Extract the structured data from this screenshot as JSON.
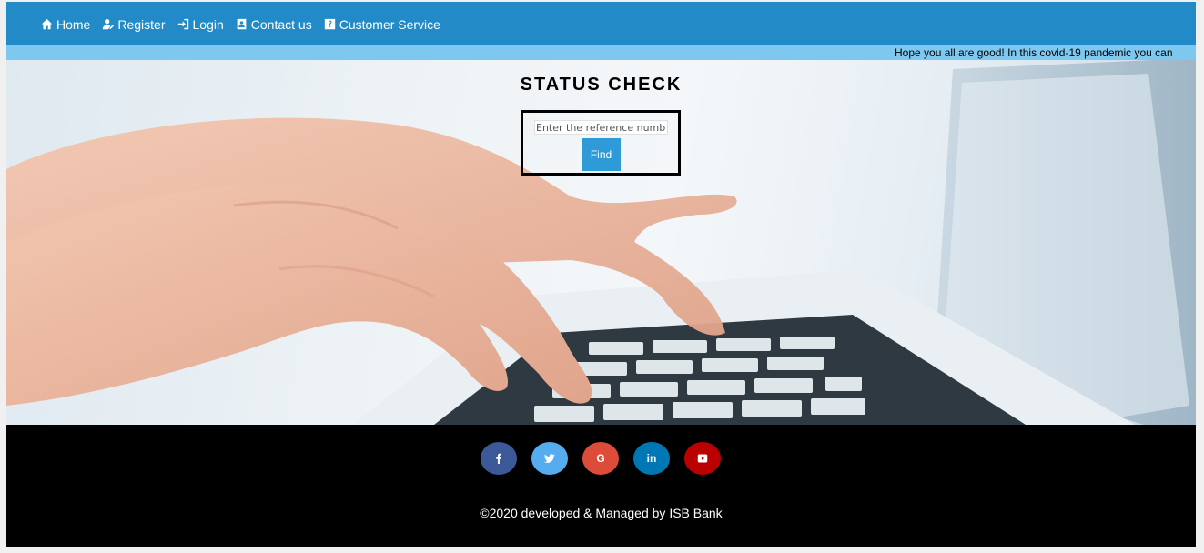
{
  "nav": {
    "items": [
      {
        "label": "Home",
        "icon": "home-icon"
      },
      {
        "label": "Register",
        "icon": "register-user-icon"
      },
      {
        "label": "Login",
        "icon": "login-icon"
      },
      {
        "label": "Contact us",
        "icon": "contact-card-icon"
      },
      {
        "label": "Customer Service",
        "icon": "help-icon"
      }
    ]
  },
  "marquee": {
    "text": "Hope you all are good! In this covid-19 pandemic you can"
  },
  "status": {
    "title": "STATUS CHECK",
    "input_placeholder": "Enter the reference number",
    "find_label": "Find"
  },
  "footer": {
    "social": [
      {
        "name": "facebook",
        "glyph": "f",
        "color": "#3b5998"
      },
      {
        "name": "twitter",
        "glyph": "t",
        "color": "#55acee"
      },
      {
        "name": "google",
        "glyph": "G",
        "color": "#dd4b39"
      },
      {
        "name": "linkedin",
        "glyph": "in",
        "color": "#0077b5"
      },
      {
        "name": "youtube",
        "glyph": "yt",
        "color": "#bb0000"
      }
    ],
    "copyright": "©2020 developed & Managed by ISB Bank"
  },
  "colors": {
    "navbar": "#228ac6",
    "marquee": "#7ec8f0",
    "button": "#2f9ad8",
    "footer": "#000000"
  }
}
